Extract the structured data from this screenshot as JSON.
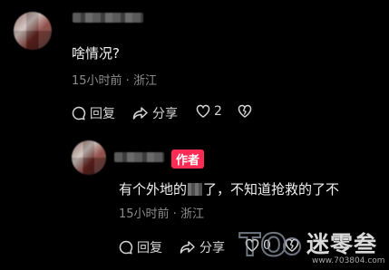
{
  "comment1": {
    "text": "啥情况?",
    "time": "15小时前",
    "sep": " · ",
    "location": "浙江",
    "reply_label": "回复",
    "share_label": "分享",
    "like_count": "2"
  },
  "comment2": {
    "badge": "作者",
    "text_before": "有个外地的",
    "text_after": "了，不知道抢救的了不",
    "time": "15小时前",
    "sep": " · ",
    "location": "浙江",
    "reply_label": "回复",
    "share_label": "分享",
    "like_count": "0"
  },
  "watermark": {
    "brand": "迷零叁",
    "url": "www.703804.com"
  },
  "colors": {
    "badge": "#fe2c55",
    "background": "#000000"
  }
}
